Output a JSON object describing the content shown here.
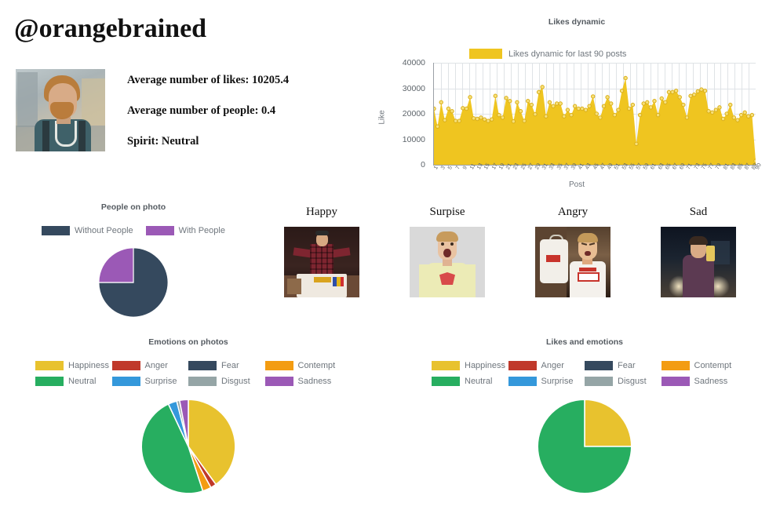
{
  "profile": {
    "handle": "@orangebrained",
    "photo_alt": "profile-photo",
    "stats": [
      "Average number of likes: 10205.4",
      "Average number of people: 0.4",
      "Spirit: Neutral"
    ]
  },
  "likes_dynamic": {
    "title": "Likes dynamic",
    "legend_label": "Likes dynamic for last 90 posts",
    "legend_color": "#efc520",
    "xlabel": "Post",
    "ylabel": "Like"
  },
  "people_on_photo": {
    "title": "People on photo",
    "legend": [
      {
        "label": "Without People",
        "color": "#35495e"
      },
      {
        "label": "With People",
        "color": "#9b59b6"
      }
    ]
  },
  "emotion_samples": {
    "items": [
      {
        "label": "Happy"
      },
      {
        "label": "Surpise"
      },
      {
        "label": "Angry"
      },
      {
        "label": "Sad"
      }
    ]
  },
  "emotions_on_photos": {
    "title": "Emotions on photos"
  },
  "likes_and_emotions": {
    "title": "Likes and emotions"
  },
  "emotion_legend": [
    {
      "label": "Happiness",
      "color": "#e8c22e"
    },
    {
      "label": "Anger",
      "color": "#c0392b"
    },
    {
      "label": "Fear",
      "color": "#35495e"
    },
    {
      "label": "Contempt",
      "color": "#f39c12"
    },
    {
      "label": "Neutral",
      "color": "#27ae60"
    },
    {
      "label": "Surprise",
      "color": "#3498db"
    },
    {
      "label": "Disgust",
      "color": "#95a5a6"
    },
    {
      "label": "Sadness",
      "color": "#9b59b6"
    }
  ],
  "chart_data": [
    {
      "type": "area",
      "title": "Likes dynamic",
      "xlabel": "Post",
      "ylabel": "Like",
      "ylim": [
        0,
        40000
      ],
      "yticks": [
        0,
        10000,
        20000,
        30000,
        40000
      ],
      "grid": true,
      "legend_position": "top",
      "series": [
        {
          "name": "Likes dynamic for last 90 posts",
          "color": "#efc520",
          "values": [
            22000,
            15000,
            24500,
            17500,
            22000,
            21000,
            17200,
            17200,
            22200,
            22000,
            26500,
            18200,
            18000,
            18500,
            17800,
            17200,
            17800,
            27000,
            19500,
            18500,
            26200,
            25000,
            17000,
            24500,
            21000,
            17200,
            25000,
            23500,
            19800,
            28500,
            30500,
            19000,
            24500,
            23000,
            24000,
            24000,
            19000,
            21500,
            19500,
            23000,
            22000,
            22000,
            21500,
            23000,
            26800,
            20000,
            18500,
            23000,
            26500,
            24000,
            19500,
            21500,
            29000,
            34000,
            22000,
            23500,
            8200,
            19500,
            24000,
            24500,
            22500,
            25000,
            19500,
            26000,
            24500,
            28500,
            28500,
            29000,
            26500,
            23500,
            18500,
            27000,
            27500,
            28800,
            29500,
            29000,
            21000,
            20500,
            21500,
            22500,
            18000,
            20000,
            23500,
            18500,
            17500,
            19500,
            20500,
            19000,
            19500,
            1500
          ],
          "x": [
            1,
            2,
            3,
            4,
            5,
            6,
            7,
            8,
            9,
            10,
            11,
            12,
            13,
            14,
            15,
            16,
            17,
            18,
            19,
            20,
            21,
            22,
            23,
            24,
            25,
            26,
            27,
            28,
            29,
            30,
            31,
            32,
            33,
            34,
            35,
            36,
            37,
            38,
            39,
            40,
            41,
            42,
            43,
            44,
            45,
            46,
            47,
            48,
            49,
            50,
            51,
            52,
            53,
            54,
            55,
            56,
            57,
            58,
            59,
            60,
            61,
            62,
            63,
            64,
            65,
            66,
            67,
            68,
            69,
            70,
            71,
            72,
            73,
            74,
            75,
            76,
            77,
            78,
            79,
            80,
            81,
            82,
            83,
            84,
            85,
            86,
            87,
            88,
            89,
            90
          ]
        }
      ],
      "xticks": [
        1,
        3,
        5,
        7,
        9,
        11,
        13,
        15,
        17,
        19,
        21,
        23,
        25,
        27,
        29,
        31,
        33,
        35,
        37,
        39,
        41,
        43,
        45,
        47,
        49,
        51,
        53,
        55,
        57,
        59,
        61,
        63,
        65,
        67,
        69,
        71,
        73,
        75,
        77,
        79,
        81,
        83,
        85,
        87,
        89,
        90
      ]
    },
    {
      "type": "pie",
      "title": "People on photo",
      "labels": [
        "Without People",
        "With People"
      ],
      "values": [
        75,
        25
      ],
      "colors": [
        "#35495e",
        "#9b59b6"
      ],
      "legend_position": "top"
    },
    {
      "type": "pie",
      "title": "Emotions on photos",
      "labels": [
        "Happiness",
        "Anger",
        "Contempt",
        "Neutral",
        "Surprise",
        "Disgust",
        "Sadness",
        "Fear"
      ],
      "values": [
        40,
        2,
        3,
        48,
        3,
        1,
        3,
        0
      ],
      "colors": [
        "#e8c22e",
        "#c0392b",
        "#f39c12",
        "#27ae60",
        "#3498db",
        "#95a5a6",
        "#9b59b6",
        "#35495e"
      ],
      "legend_position": "top"
    },
    {
      "type": "pie",
      "title": "Likes and emotions",
      "labels": [
        "Happiness",
        "Neutral"
      ],
      "values": [
        25,
        75
      ],
      "colors": [
        "#e8c22e",
        "#27ae60"
      ],
      "legend_position": "top"
    }
  ]
}
